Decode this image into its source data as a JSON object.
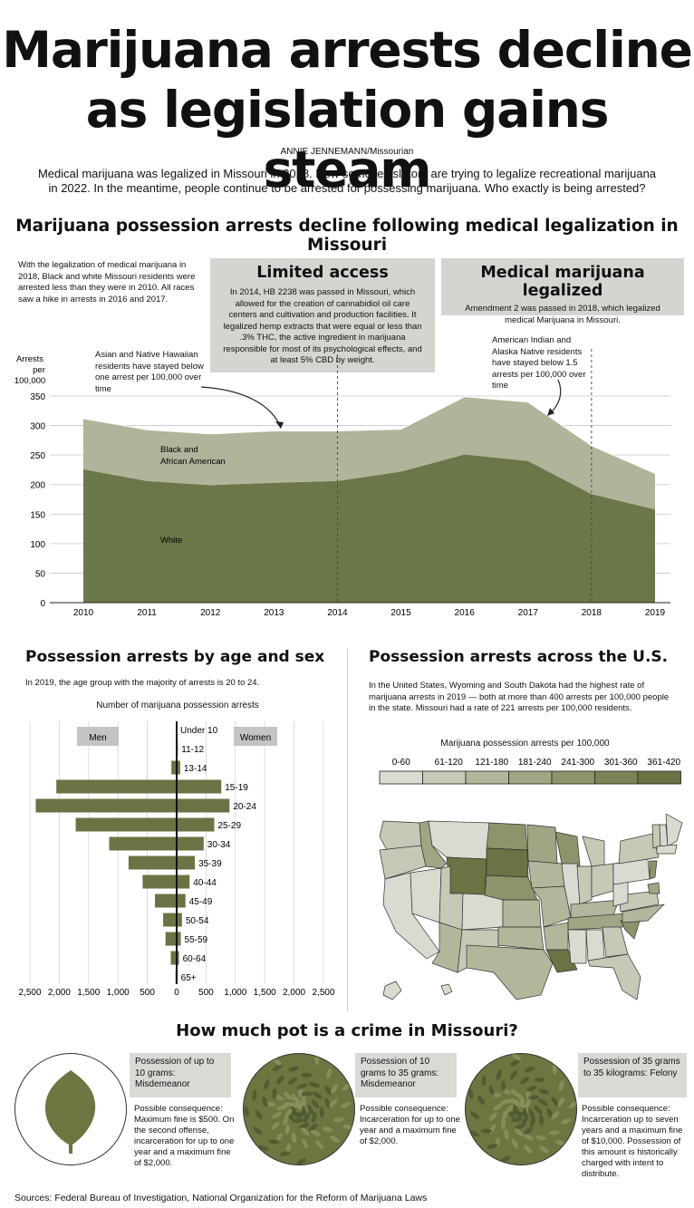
{
  "headline": "Marijuana arrests decline as legislation gains steam",
  "byline": "ANNIE JENNEMANN/Missourian",
  "intro": "Medical marijuana was legalized in Missouri in 2018. Now some legislators are trying to legalize recreational marijuana in 2022. In the meantime, people continue to be arrested for possessing marijuana. Who exactly is being arrested?",
  "colors": {
    "dark": "#6b7748",
    "light": "#b0b49a",
    "bar": "#6b7344",
    "gray_box": "#d4d4d0"
  },
  "chart_data": [
    {
      "type": "area",
      "title": "Marijuana possession arrests decline following medical legalization in Missouri",
      "ylabel": "Arrests per 100,000",
      "x": [
        2010,
        2011,
        2012,
        2013,
        2014,
        2015,
        2016,
        2017,
        2018,
        2019
      ],
      "ylim": [
        0,
        350
      ],
      "yticks": [
        0,
        50,
        100,
        150,
        200,
        250,
        300,
        350
      ],
      "stacked": true,
      "series": [
        {
          "name": "White",
          "values": [
            226,
            206,
            199,
            203,
            206,
            222,
            251,
            240,
            184,
            158
          ]
        },
        {
          "name": "Black and African American",
          "values": [
            86,
            87,
            87,
            88,
            85,
            72,
            98,
            100,
            82,
            61
          ]
        }
      ],
      "reference_lines": [
        2014,
        2018
      ],
      "grid": "horizontal"
    },
    {
      "type": "bar",
      "orientation": "horizontal",
      "title": "Possession arrests by age and sex",
      "xlabel": "Number of marijuana possession arrests",
      "categories": [
        "Under 10",
        "11-12",
        "13-14",
        "15-19",
        "20-24",
        "25-29",
        "30-34",
        "35-39",
        "40-44",
        "45-49",
        "50-54",
        "55-59",
        "60-64",
        "65+"
      ],
      "series": [
        {
          "name": "Men",
          "values": [
            0,
            10,
            90,
            2050,
            2400,
            1720,
            1150,
            820,
            580,
            370,
            230,
            190,
            100,
            20
          ]
        },
        {
          "name": "Women",
          "values": [
            0,
            20,
            60,
            760,
            900,
            640,
            460,
            310,
            220,
            150,
            90,
            70,
            40,
            10
          ]
        }
      ],
      "xlim": [
        -2500,
        2500
      ],
      "xticks": [
        "2,500",
        "2,000",
        "1,500",
        "1,000",
        "500",
        "0",
        "500",
        "1,000",
        "1,500",
        "2,000",
        "2,500"
      ],
      "grid": "vertical"
    }
  ],
  "chart1": {
    "note": "With the legalization of medical marijuana in 2018, Black and white Missouri residents were arrested less than they were in 2010.  All races saw a hike in arrests in 2016 and 2017.",
    "ylabel_lines": [
      "Arrests",
      "per",
      "100,000"
    ],
    "label_black_lines": [
      "Black and",
      "African American"
    ],
    "label_white": "White",
    "limited_title": "Limited access",
    "limited_text": "In 2014, HB 2238 was passed in Missouri, which allowed for the creation of cannabidiol oil care centers and cultivation and production facilities. It legalized hemp extracts that were equal or less than .3% THC, the active ingredient in marijuana responsible for most of its psychological effects, and at least 5% CBD by weight.",
    "medical_title": "Medical marijuana legalized",
    "medical_text": "Amendment 2 was passed in 2018, which legalized medical Marijuana in Missouri.",
    "ann_asian": "Asian and Native Hawaiian residents have stayed below one arrest per 100,000 over time",
    "ann_amind": "American Indian and Alaska Native residents have stayed below 1.5 arrests per 100,000 over time"
  },
  "chart2": {
    "note": "In 2019, the age group with the majority of arrests is 20 to 24.",
    "men_label": "Men",
    "women_label": "Women"
  },
  "us_map": {
    "title": "Possession arrests across the U.S.",
    "note": "In the United States, Wyoming and South Dakota had the highest rate of marijuana arrests in 2019 — both at more than 400 arrests per 100,000 people in the state. Missouri had a rate of 221 arrests per 100,000 residents.",
    "legend_title": "Marijuana possession arrests per 100,000",
    "bins": [
      "0-60",
      "61-120",
      "121-180",
      "181-240",
      "241-300",
      "301-360",
      "361-420"
    ],
    "bin_colors": [
      "#d9dbd0",
      "#c5c9b5",
      "#b2b79c",
      "#9fa683",
      "#8c946b",
      "#7a8355",
      "#697343"
    ]
  },
  "pot": {
    "title": "How much pot is a crime in Missouri?",
    "items": [
      {
        "head": "Possession of up to 10 grams: Misdemeanor",
        "body": "Possible consequence: Maximum fine is $500. On the second offense, incarceration for up to one year and a maximum fine of $2,000."
      },
      {
        "head": "Possession of 10 grams to 35 grams: Misdemeanor",
        "body": "Possible consequence: Incarceration for up to one year and a maximum fine of $2,000."
      },
      {
        "head": "Possession of 35 grams to 35 kilograms: Felony",
        "body": "Possible consequence: Incarceration up to seven years and a maximum fine of $10,000. Possession of this amount is historically charged with intent to distribute."
      }
    ]
  },
  "sources": "Sources: Federal Bureau of Investigation, National Organization for the Reform of Marijuana Laws"
}
